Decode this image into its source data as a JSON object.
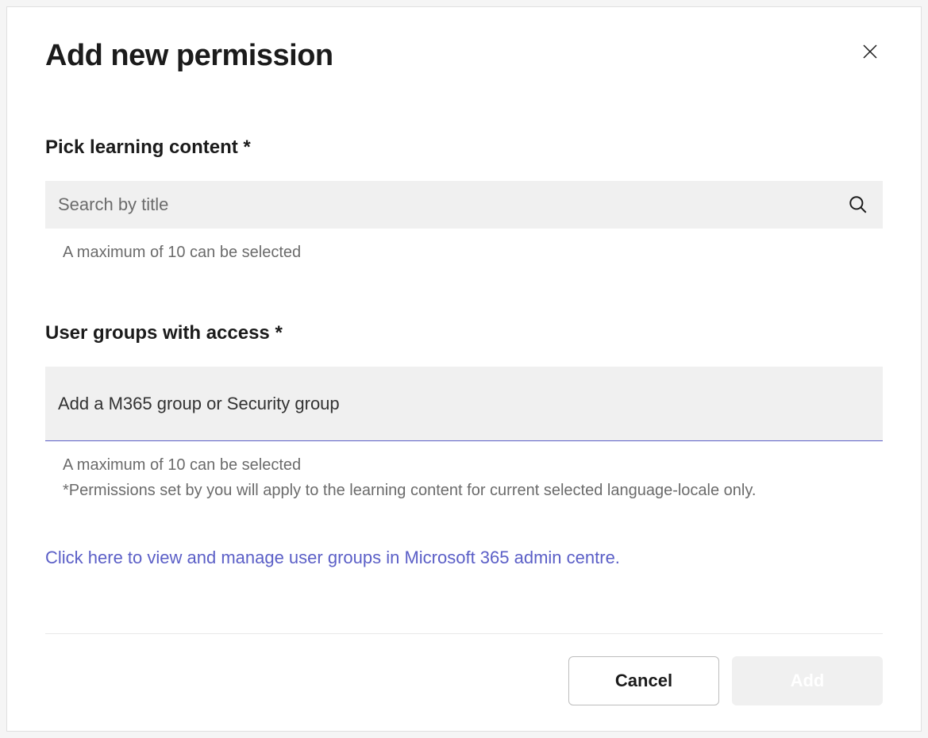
{
  "dialog": {
    "title": "Add new permission"
  },
  "learningContent": {
    "label": "Pick learning content *",
    "placeholder": "Search by title",
    "helper": "A maximum of 10 can be selected"
  },
  "userGroups": {
    "label": "User groups with access *",
    "placeholder": "Add a M365 group or Security group",
    "helper1": "A maximum of 10 can be selected",
    "helper2": "*Permissions set by you will apply to the learning content for current selected language-locale only."
  },
  "link": {
    "text": "Click here to view and manage user groups in Microsoft 365 admin centre."
  },
  "footer": {
    "cancel": "Cancel",
    "add": "Add"
  }
}
